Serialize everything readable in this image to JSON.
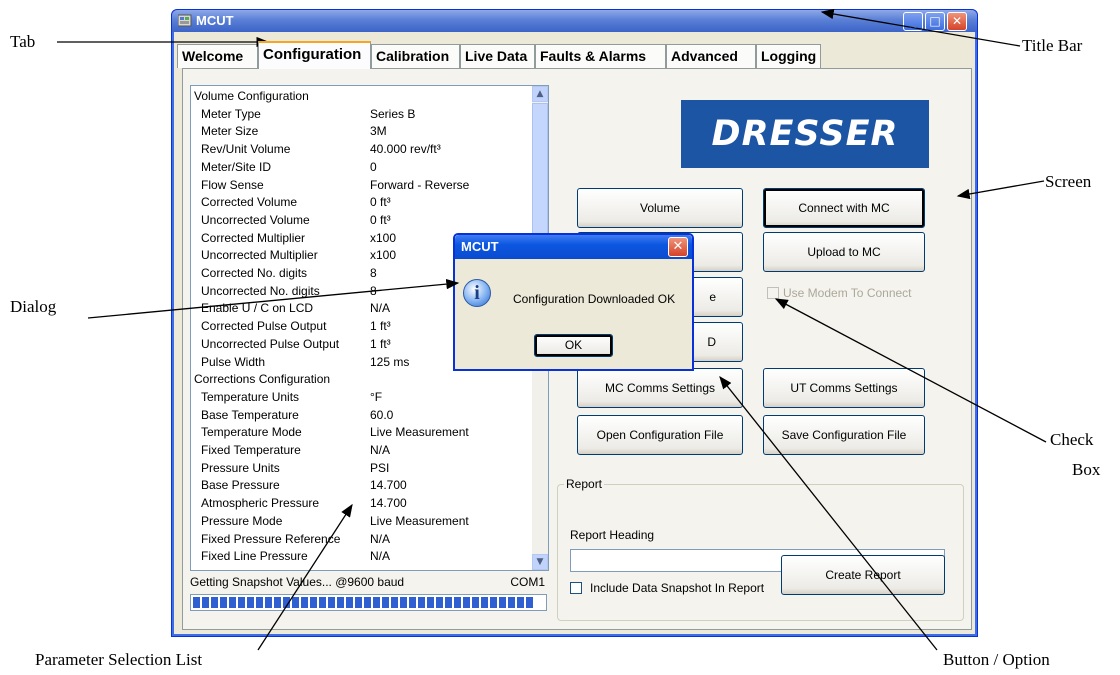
{
  "annotations": {
    "tab": "Tab",
    "title_bar": "Title Bar",
    "screen": "Screen",
    "dialog": "Dialog",
    "check_box_line1": "Check",
    "check_box_line2": "Box",
    "parameter_list": "Parameter Selection List",
    "button_option": "Button / Option"
  },
  "window": {
    "title": "MCUT"
  },
  "tabs": [
    "Welcome",
    "Configuration",
    "Calibration",
    "Live Data",
    "Faults & Alarms",
    "Advanced",
    "Logging"
  ],
  "active_tab": "Configuration",
  "parameters": [
    {
      "k": "Volume Configuration",
      "v": "",
      "head": true
    },
    {
      "k": "Meter Type",
      "v": "Series B"
    },
    {
      "k": "Meter Size",
      "v": "3M"
    },
    {
      "k": "Rev/Unit Volume",
      "v": "40.000 rev/ft³"
    },
    {
      "k": "Meter/Site ID",
      "v": "0"
    },
    {
      "k": "Flow Sense",
      "v": "Forward - Reverse"
    },
    {
      "k": "Corrected Volume",
      "v": "0 ft³"
    },
    {
      "k": "Uncorrected Volume",
      "v": "0 ft³"
    },
    {
      "k": "Corrected Multiplier",
      "v": "x100"
    },
    {
      "k": "Uncorrected Multiplier",
      "v": "x100"
    },
    {
      "k": "Corrected No. digits",
      "v": "8"
    },
    {
      "k": "Uncorrected No. digits",
      "v": "8"
    },
    {
      "k": "Enable U / C on LCD",
      "v": "N/A"
    },
    {
      "k": "Corrected Pulse Output",
      "v": "1 ft³"
    },
    {
      "k": "Uncorrected Pulse Output",
      "v": "1 ft³"
    },
    {
      "k": "Pulse Width",
      "v": "125 ms"
    },
    {
      "k": "Corrections Configuration",
      "v": "",
      "head": true
    },
    {
      "k": "Temperature Units",
      "v": "°F"
    },
    {
      "k": "Base Temperature",
      "v": "60.0"
    },
    {
      "k": "Temperature Mode",
      "v": "Live Measurement"
    },
    {
      "k": "Fixed Temperature",
      "v": "N/A"
    },
    {
      "k": "Pressure Units",
      "v": "PSI"
    },
    {
      "k": "Base Pressure",
      "v": "14.700"
    },
    {
      "k": "Atmospheric Pressure",
      "v": "14.700"
    },
    {
      "k": "Pressure Mode",
      "v": "Live Measurement"
    },
    {
      "k": "Fixed Pressure Reference",
      "v": "N/A"
    },
    {
      "k": "Fixed Line Pressure",
      "v": "N/A"
    }
  ],
  "status": {
    "text": "Getting Snapshot Values... @9600 baud",
    "port": "COM1",
    "progress": 0.98
  },
  "logo_text": "DRESSER",
  "buttons": {
    "volume": "Volume",
    "connect": "Connect with MC",
    "upload": "Upload to MC",
    "btn3_partial": "e",
    "btn4_partial": "D",
    "mc_comms": "MC Comms Settings",
    "ut_comms": "UT Comms Settings",
    "open_config": "Open Configuration File",
    "save_config": "Save Configuration File",
    "create_report": "Create Report"
  },
  "modem_checkbox": "Use Modem To Connect",
  "report": {
    "group_title": "Report",
    "heading_label": "Report Heading",
    "heading_value": "",
    "include_snapshot": "Include Data Snapshot In Report"
  },
  "dialog": {
    "title": "MCUT",
    "message": "Configuration Downloaded OK",
    "ok": "OK"
  }
}
